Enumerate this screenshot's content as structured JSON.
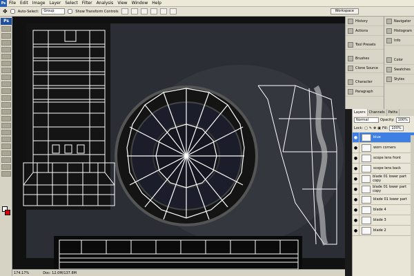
{
  "menu": [
    "File",
    "Edit",
    "Image",
    "Layer",
    "Select",
    "Filter",
    "Analysis",
    "View",
    "Window",
    "Help"
  ],
  "options": {
    "auto_select_label": "Auto-Select:",
    "auto_select_value": "Group",
    "transform_label": "Show Transform Controls",
    "workspace_label": "Workspace"
  },
  "toolbox": {
    "badge": "Ps"
  },
  "dock_left": [
    "History",
    "Actions",
    "Tool Presets",
    "Brushes",
    "Clone Source",
    "Character",
    "Paragraph"
  ],
  "dock_right": [
    "Navigator",
    "Histogram",
    "Info",
    "Color",
    "Swatches",
    "Styles"
  ],
  "layers_panel": {
    "tabs": [
      "Layers",
      "Channels",
      "Paths"
    ],
    "blend_mode": "Normal",
    "opacity_label": "Opacity:",
    "opacity": "100%",
    "lock_label": "Lock:",
    "fill_label": "Fill:",
    "fill": "100%",
    "layers": [
      "blue",
      "worn corners",
      "scope lens front",
      "scope lens back",
      "blade 01 lower part copy",
      "blade 01 lower part copy",
      "blade 01 lower part",
      "blade 4",
      "blade 3",
      "blade 2"
    ]
  },
  "status": {
    "zoom": "174.17%",
    "doc": "Doc: 12.0M/137.8M"
  },
  "colors": {
    "selected_layer": "#3d7fe3",
    "background_swatch": "#dd0000"
  }
}
